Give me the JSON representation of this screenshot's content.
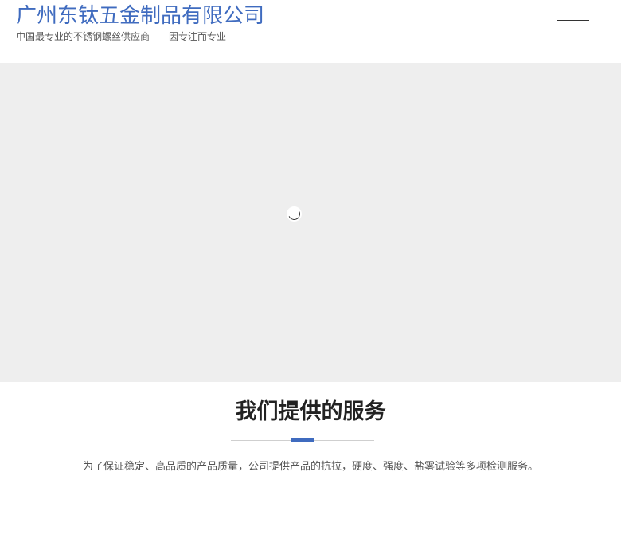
{
  "header": {
    "title": "广州东钛五金制品有限公司",
    "slogan": "中国最专业的不锈钢螺丝供应商——因专注而专业",
    "menu_icon": "hamburger-menu-icon"
  },
  "banner": {
    "loading_icon": "loading-spinner-icon"
  },
  "services": {
    "title": "我们提供的服务",
    "description": "为了保证稳定、高品质的产品质量，公司提供产品的抗拉，硬度、强度、盐雾试验等多项检测服务。"
  },
  "colors": {
    "brand": "#3f6bbf",
    "banner_bg": "#eeeeee",
    "text": "#333333"
  }
}
